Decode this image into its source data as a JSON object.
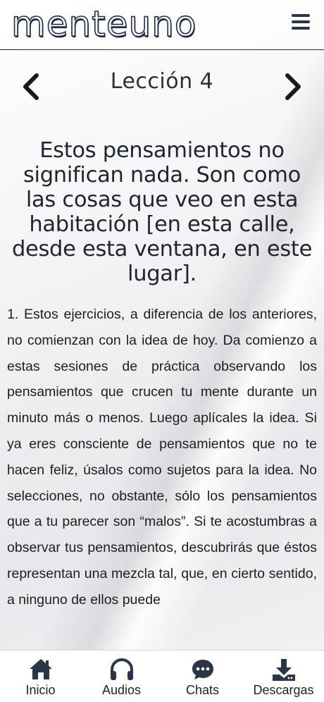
{
  "header": {
    "logo_text": "menteuno",
    "menu_icon": "hamburger-icon"
  },
  "lesson_nav": {
    "title": "Lección 4",
    "prev_icon": "chevron-left-icon",
    "next_icon": "chevron-right-icon"
  },
  "lesson": {
    "headline": "Estos pensamientos no significan nada. Son como las cosas que veo en esta habitación [en esta calle, desde esta ventana, en este lugar].",
    "body": "1. Estos ejercicios, a diferencia de los anteriores, no comienzan con la idea de hoy. Da comienzo a estas sesiones de práctica observando los pensamientos que crucen tu mente durante un minuto más o menos. Luego aplícales la idea. Si ya eres consciente de pensamientos que no te hacen feliz, úsalos como sujetos para la idea. No selecciones, no obstante, sólo los pensamientos que a tu parecer son “malos”. Si te acostumbras a observar tus pensamientos, descubrirás que éstos representan una mezcla tal, que, en cierto sentido, a ninguno de ellos puede"
  },
  "bottom_nav": {
    "items": [
      {
        "label": "Inicio",
        "icon": "home-icon"
      },
      {
        "label": "Audios",
        "icon": "headphones-icon"
      },
      {
        "label": "Chats",
        "icon": "chat-bubble-icon"
      },
      {
        "label": "Descargas",
        "icon": "download-icon"
      }
    ]
  },
  "colors": {
    "logo_outline": "#1f2a44",
    "icon_dark": "#2b3548",
    "text": "#1e1e1e"
  }
}
